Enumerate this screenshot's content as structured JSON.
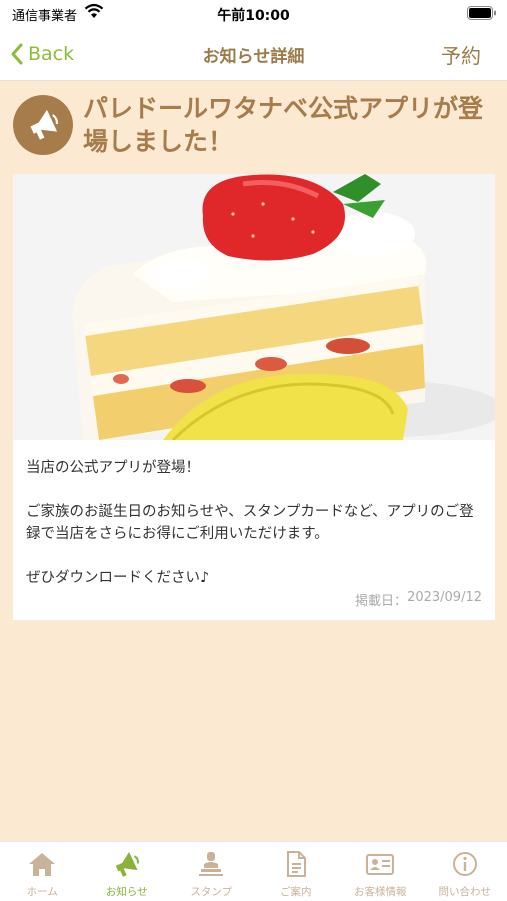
{
  "status_bar": {
    "carrier": "通信事業者",
    "time": "午前10:00"
  },
  "nav": {
    "back_label": "Back",
    "title": "お知らせ詳細",
    "reserve_label": "予約"
  },
  "notice": {
    "title": "パレドールワタナベ公式アプリが登場しました！",
    "body": [
      "当店の公式アプリが登場！",
      "ご家族のお誕生日のお知らせや、スタンプカードなど、アプリのご登録で当店をさらにお得にご利用いただけます。",
      "ぜひダウンロードください♪"
    ],
    "posted_label": "掲載日：",
    "posted_date": "2023/09/12"
  },
  "tabs": [
    {
      "label": "ホーム",
      "icon": "home-icon"
    },
    {
      "label": "お知らせ",
      "icon": "megaphone-icon",
      "active": true
    },
    {
      "label": "スタンプ",
      "icon": "stamp-icon"
    },
    {
      "label": "ご案内",
      "icon": "document-icon"
    },
    {
      "label": "お客様情報",
      "icon": "id-card-icon"
    },
    {
      "label": "問い合わせ",
      "icon": "info-icon"
    }
  ],
  "colors": {
    "background": "#fbe9d2",
    "accent_brown": "#a77c4b",
    "accent_green": "#8dbb3c",
    "tab_inactive": "#c8b39a"
  }
}
